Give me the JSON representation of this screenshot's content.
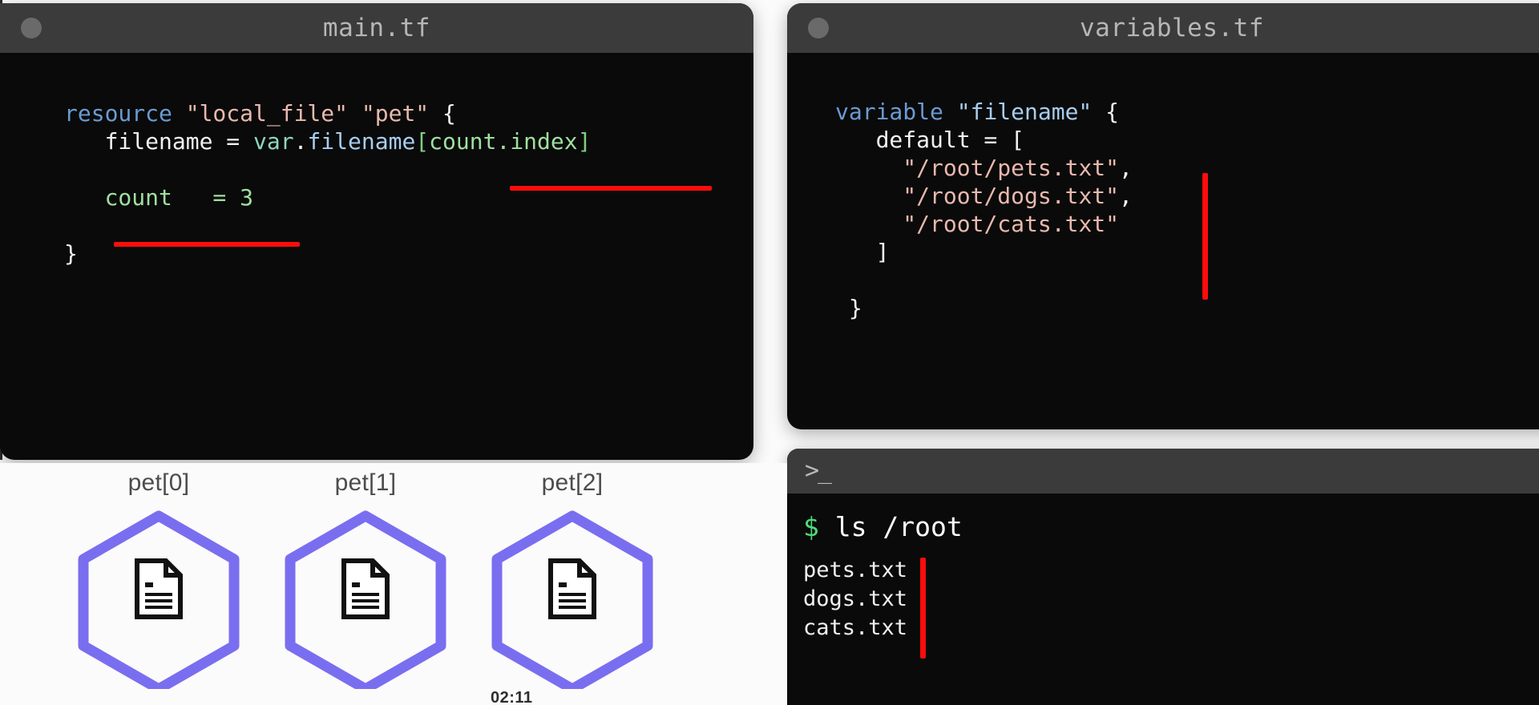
{
  "editors": [
    {
      "id": "main",
      "title": "main.tf",
      "window_dot": "window-dot",
      "lines": [
        [
          {
            "t": "resource ",
            "c": "kw"
          },
          {
            "t": "\"local_file\" \"pet\"",
            "c": "str"
          },
          {
            "t": " {",
            "c": "pln"
          }
        ],
        [
          {
            "t": "   filename = ",
            "c": "pln"
          },
          {
            "t": "var",
            "c": "var"
          },
          {
            "t": ".",
            "c": "pln"
          },
          {
            "t": "filename",
            "c": "fld"
          },
          {
            "t": "[",
            "c": "brk"
          },
          {
            "t": "count.index",
            "c": "grn"
          },
          {
            "t": "]",
            "c": "brk"
          }
        ],
        [
          {
            "t": "",
            "c": "pln"
          }
        ],
        [
          {
            "t": "   count   = 3",
            "c": "grn"
          }
        ],
        [
          {
            "t": "",
            "c": "pln"
          }
        ],
        [
          {
            "t": "}",
            "c": "pln"
          }
        ]
      ]
    },
    {
      "id": "vars",
      "title": "variables.tf",
      "window_dot": "window-dot",
      "lines": [
        [
          {
            "t": "variable ",
            "c": "kw"
          },
          {
            "t": "\"filename\"",
            "c": "fld"
          },
          {
            "t": " {",
            "c": "pln"
          }
        ],
        [
          {
            "t": "   default = [",
            "c": "pln"
          }
        ],
        [
          {
            "t": "     ",
            "c": "pln"
          },
          {
            "t": "\"/root/pets.txt\"",
            "c": "str"
          },
          {
            "t": ",",
            "c": "pln"
          }
        ],
        [
          {
            "t": "     ",
            "c": "pln"
          },
          {
            "t": "\"/root/dogs.txt\"",
            "c": "str"
          },
          {
            "t": ",",
            "c": "pln"
          }
        ],
        [
          {
            "t": "     ",
            "c": "pln"
          },
          {
            "t": "\"/root/cats.txt\"",
            "c": "str"
          }
        ],
        [
          {
            "t": "   ]",
            "c": "pln"
          }
        ],
        [
          {
            "t": "",
            "c": "pln"
          }
        ],
        [
          {
            "t": " }",
            "c": "pln"
          }
        ]
      ]
    }
  ],
  "terminal": {
    "prompt_icon": "prompt-icon",
    "prompt_glyph": ">_",
    "sigil": "$",
    "command": " ls /root",
    "output": [
      "pets.txt",
      "dogs.txt",
      "cats.txt"
    ]
  },
  "annotations": {
    "color": "#fb0d0d",
    "marks": [
      {
        "name": "underline-count-index",
        "kind": "underline"
      },
      {
        "name": "underline-count-three",
        "kind": "underline"
      },
      {
        "name": "bar-variable-list",
        "kind": "vbar"
      },
      {
        "name": "bar-terminal-output",
        "kind": "vbar"
      }
    ]
  },
  "diagram": {
    "hex_stroke": "#7a6ef0",
    "nodes": [
      {
        "label": "pet[0]",
        "icon": "document-icon"
      },
      {
        "label": "pet[1]",
        "icon": "document-icon"
      },
      {
        "label": "pet[2]",
        "icon": "document-icon"
      }
    ]
  },
  "timestamp": "02:11"
}
